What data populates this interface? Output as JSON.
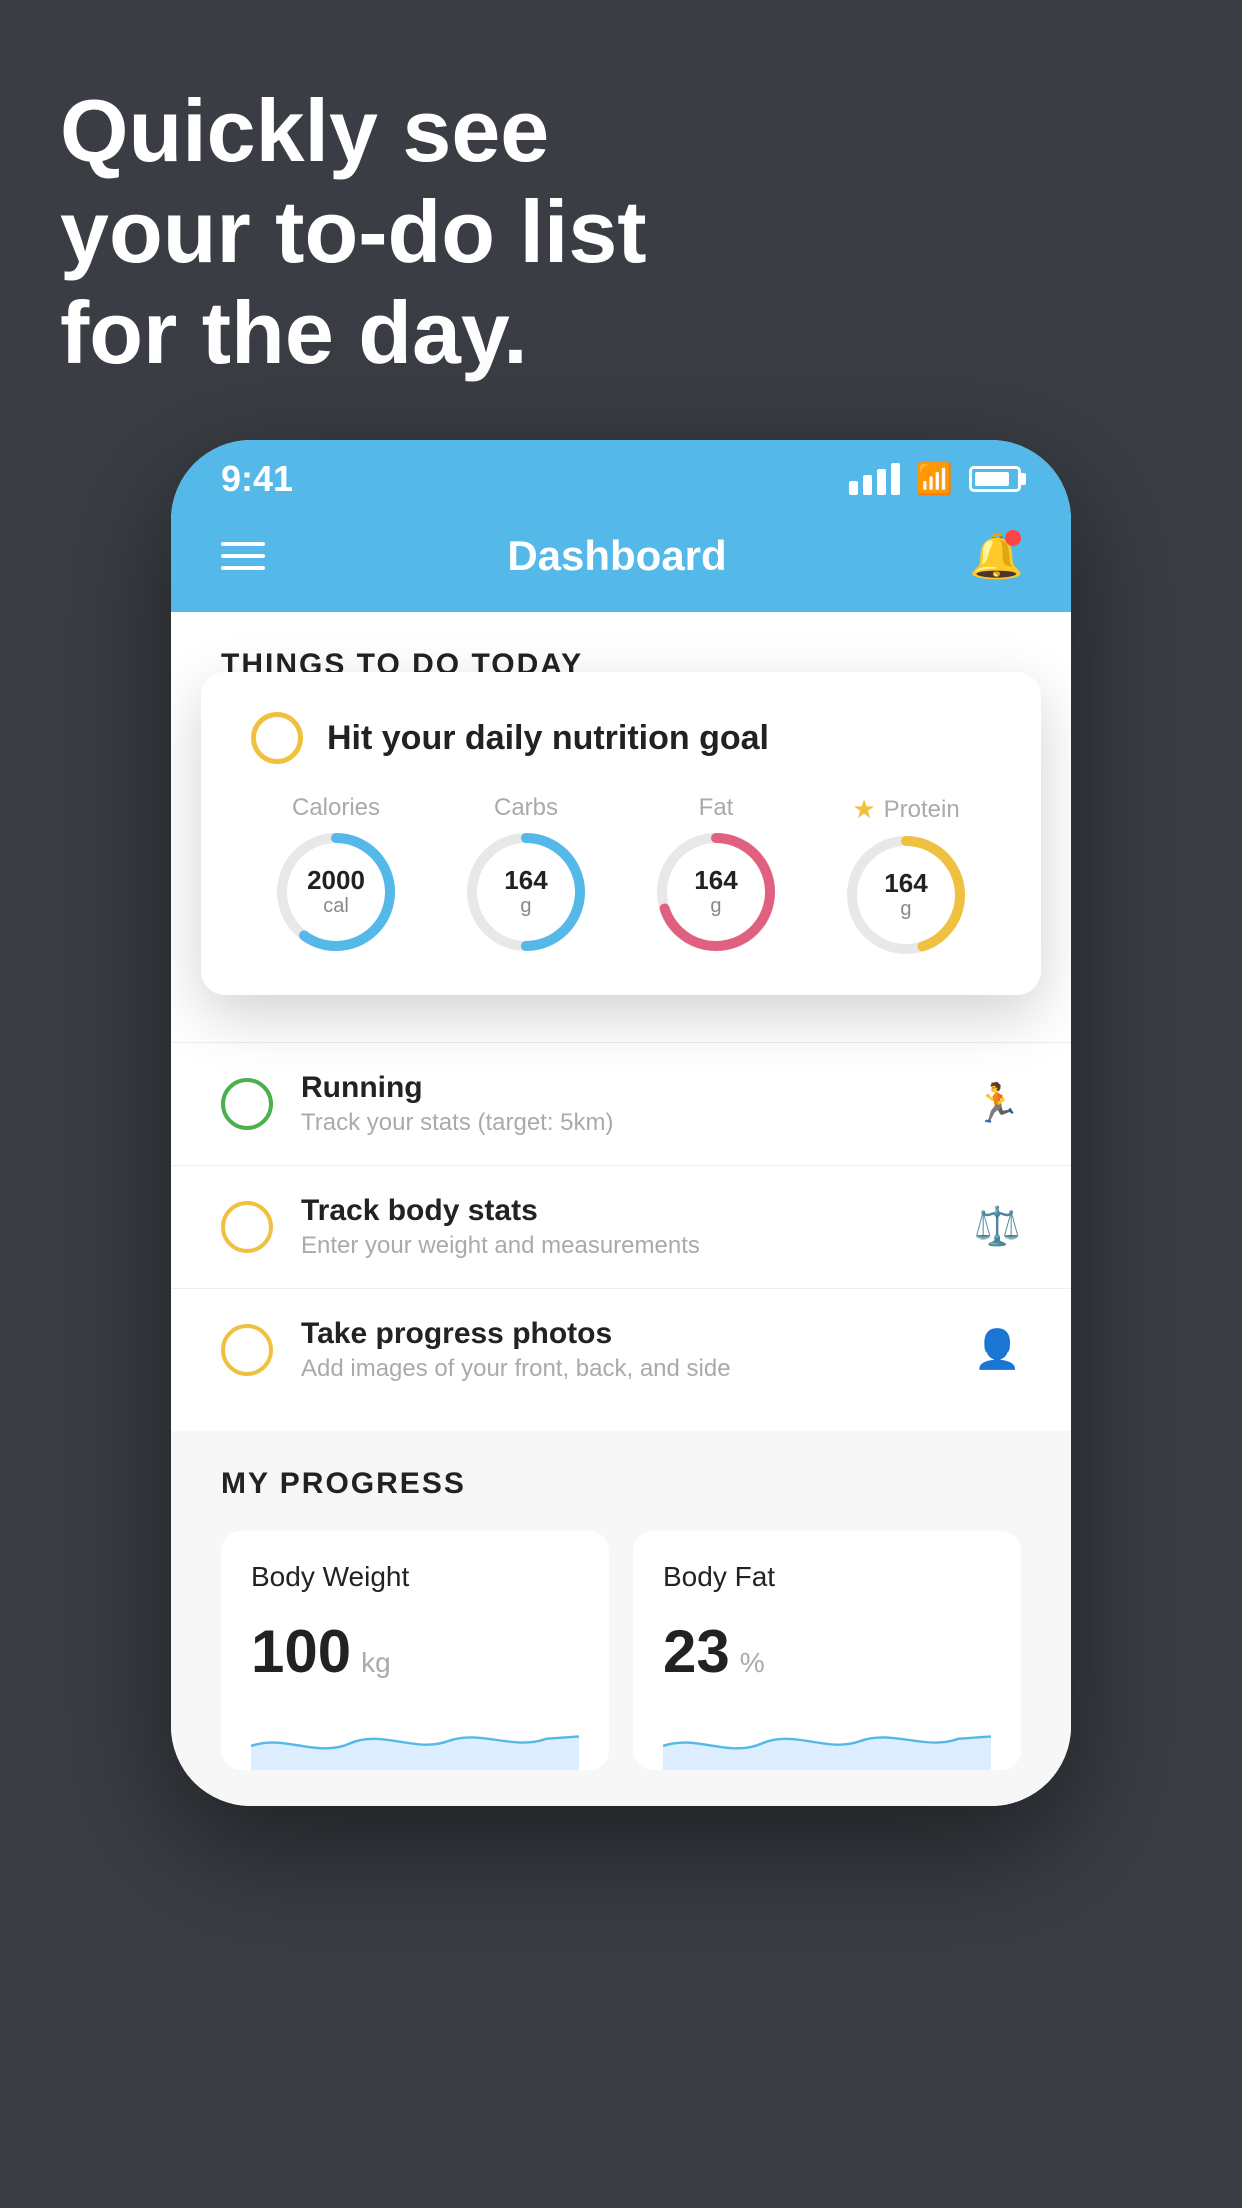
{
  "headline": {
    "line1": "Quickly see",
    "line2": "your to-do list",
    "line3": "for the day."
  },
  "statusBar": {
    "time": "9:41"
  },
  "navBar": {
    "title": "Dashboard"
  },
  "thingsSection": {
    "header": "THINGS TO DO TODAY"
  },
  "nutritionCard": {
    "title": "Hit your daily nutrition goal",
    "stats": [
      {
        "label": "Calories",
        "value": "2000",
        "unit": "cal",
        "color": "#54b8e8",
        "pct": 60
      },
      {
        "label": "Carbs",
        "value": "164",
        "unit": "g",
        "color": "#54b8e8",
        "pct": 50
      },
      {
        "label": "Fat",
        "value": "164",
        "unit": "g",
        "color": "#e06080",
        "pct": 70
      },
      {
        "label": "Protein",
        "value": "164",
        "unit": "g",
        "color": "#f0c040",
        "pct": 45,
        "star": true
      }
    ]
  },
  "todoItems": [
    {
      "title": "Running",
      "subtitle": "Track your stats (target: 5km)",
      "circleColor": "green",
      "icon": "🏃"
    },
    {
      "title": "Track body stats",
      "subtitle": "Enter your weight and measurements",
      "circleColor": "yellow",
      "icon": "⚖️"
    },
    {
      "title": "Take progress photos",
      "subtitle": "Add images of your front, back, and side",
      "circleColor": "yellow",
      "icon": "👤"
    }
  ],
  "progressSection": {
    "header": "MY PROGRESS",
    "cards": [
      {
        "title": "Body Weight",
        "value": "100",
        "unit": "kg"
      },
      {
        "title": "Body Fat",
        "value": "23",
        "unit": "%"
      }
    ]
  }
}
